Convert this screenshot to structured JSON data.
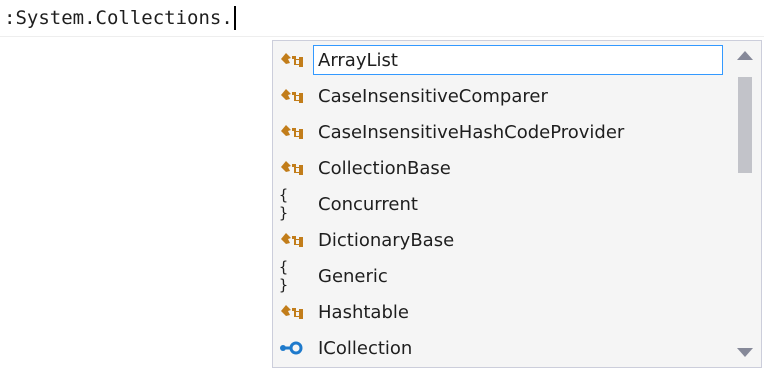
{
  "editor": {
    "code_text": ":System.Collections."
  },
  "completion": {
    "selected_index": 0,
    "items": [
      {
        "label": "ArrayList",
        "kind": "class",
        "icon": "class-icon"
      },
      {
        "label": "CaseInsensitiveComparer",
        "kind": "class",
        "icon": "class-icon"
      },
      {
        "label": "CaseInsensitiveHashCodeProvider",
        "kind": "class",
        "icon": "class-icon"
      },
      {
        "label": "CollectionBase",
        "kind": "class",
        "icon": "class-icon"
      },
      {
        "label": "Concurrent",
        "kind": "namespace",
        "icon": "namespace-icon",
        "glyph": "{ }"
      },
      {
        "label": "DictionaryBase",
        "kind": "class",
        "icon": "class-icon"
      },
      {
        "label": "Generic",
        "kind": "namespace",
        "icon": "namespace-icon",
        "glyph": "{ }"
      },
      {
        "label": "Hashtable",
        "kind": "class",
        "icon": "class-icon"
      },
      {
        "label": "ICollection",
        "kind": "interface",
        "icon": "interface-icon"
      }
    ]
  },
  "colors": {
    "class_icon": "#c27d1a",
    "interface_icon": "#1e7acc",
    "selection_border": "#3399ff"
  }
}
